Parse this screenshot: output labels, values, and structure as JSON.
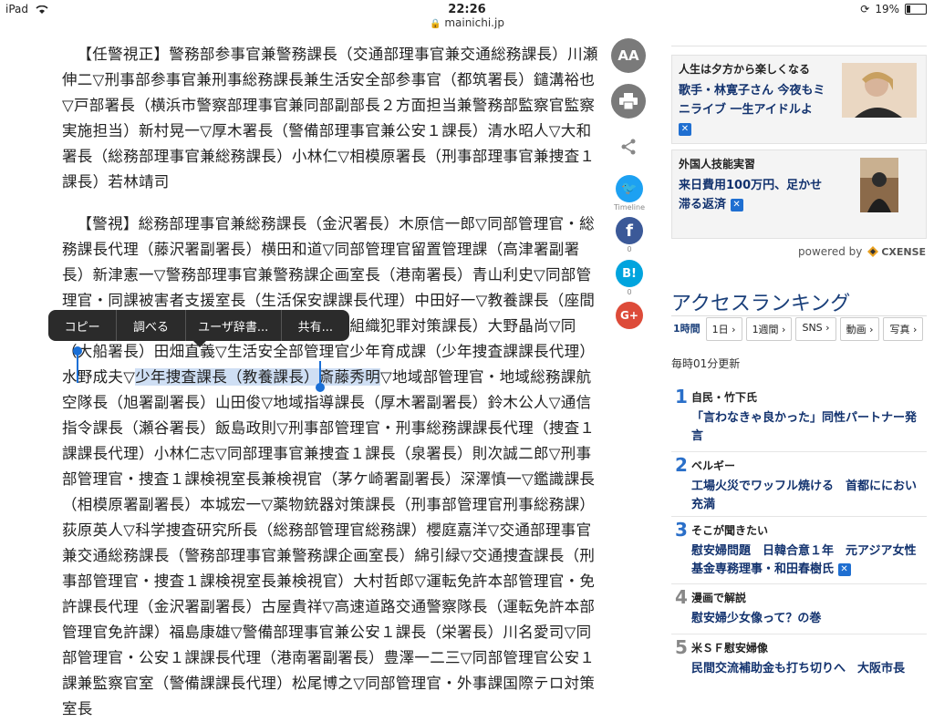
{
  "status": {
    "device": "iPad",
    "time": "22:26",
    "battery": "19%",
    "url": "mainichi.jp"
  },
  "article": {
    "para1": "【任警視正】警務部参事官兼警務課長（交通部理事官兼交通総務課長）川瀬伸二▽刑事部参事官兼刑事総務課長兼生活安全部参事官（都筑署長）鑓溝裕也▽戸部署長（横浜市警察部理事官兼同部副部長２方面担当兼警務部監察官監察実施担当）新村晃一▽厚木署長（警備部理事官兼公安１課長）清水昭人▽大和署長（総務部理事官兼総務課長）小林仁▽相模原署長（刑事部理事官兼捜査１課長）若林靖司",
    "para2_a": "【警視】総務部理事官兼総務課長（金沢署長）木原信一郎▽同部管理官・総務課長代理（藤沢署副署長）横田和道▽同部管理官留置管理課（高津署副署長）新津憲一▽警務部理事官兼警務課企画室長（港南署長）青山利史▽同部管理官・同課被害者支援室長（生活保安課課長代理）中田好一▽教養課長（座間署長）山中正▽同部管理官・少年育成課・組織犯罪対策課長）大野晶尚▽同（大船署長）田畑直義▽生活安全部管理官少年育成課（少年捜査課課長代理）水野成夫▽",
    "para2_sel": "少年捜査課長（教養課長）斎藤秀明",
    "para2_b": "▽地域部管理官・地域総務課航空隊長（旭署副署長）山田俊▽地域指導課長（厚木署副署長）鈴木公人▽通信指令課長（瀬谷署長）飯島政則▽刑事部管理官・刑事総務課課長代理（捜査１課課長代理）小林仁志▽同部理事官兼捜査１課長（泉署長）則次誠二郎▽刑事部管理官・捜査１課検視室長兼検視官（茅ケ崎署副署長）深澤慎一▽鑑識課長（相模原署副署長）本城宏一▽薬物銃器対策課長（刑事部管理官刑事総務課）荻原英人▽科学捜査研究所長（総務部管理官総務課）櫻庭嘉洋▽交通部理事官兼交通総務課長（警務部理事官兼警務課企画室長）綿引緑▽交通捜査課長（刑事部管理官・捜査１課検視室長兼検視官）大村哲郎▽運転免許本部管理官・免許課長代理（金沢署副署長）古屋貴祥▽高速道路交通警察隊長（運転免許本部管理官免許課）福島康雄▽警備部理事官兼公安１課長（栄署長）川名愛司▽同部管理官・公安１課課長代理（港南署副署長）豊澤一二三▽同部管理官公安１課兼監察官室（警備課課長代理）松尾博之▽同部管理官・外事課国際テロ対策室長"
  },
  "popup": {
    "copy": "コピー",
    "lookup": "調べる",
    "dict": "ユーザ辞書...",
    "share": "共有..."
  },
  "share": {
    "font": "AA",
    "twitter_label": "Timeline",
    "fb_count": "0",
    "hatena_count": "0"
  },
  "recommend": [
    {
      "head": "人生は夕方から楽しくなる",
      "body1": "歌手・林寛子さん 今夜もミ",
      "body2": "ニライブ 一生アイドルよ"
    },
    {
      "head": "外国人技能実習",
      "body1": "来日費用100万円、足かせ",
      "body2": "滞る返済"
    }
  ],
  "powered_by": "powered by",
  "cxense": "CXENSE",
  "ranking": {
    "title": "アクセスランキング",
    "tabs": [
      "1時間",
      "1日",
      "1週間",
      "SNS",
      "動画",
      "写真"
    ],
    "update": "毎時01分更新",
    "items": [
      {
        "num": "1",
        "cat": "自民・竹下氏",
        "title": "「言わなきゃ良かった」同性パートナー発言"
      },
      {
        "num": "2",
        "cat": "ベルギー",
        "title": "工場火災でワッフル焼ける　首都ににおい充満"
      },
      {
        "num": "3",
        "cat": "そこが聞きたい",
        "title": "慰安婦問題　日韓合意１年　元アジア女性基金専務理事・和田春樹氏"
      },
      {
        "num": "4",
        "cat": "漫画で解説",
        "title": "慰安婦少女像って？の巻"
      },
      {
        "num": "5",
        "cat": "米ＳＦ慰安婦像",
        "title": "民間交流補助金も打ち切りへ　大阪市長"
      }
    ]
  }
}
